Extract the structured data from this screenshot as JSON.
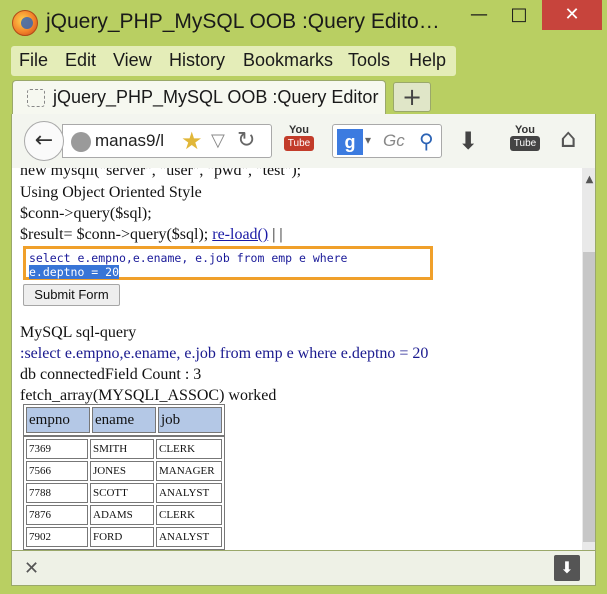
{
  "window": {
    "title": "jQuery_PHP_MySQL OOB :Query Edito…",
    "minimize": "—",
    "maximize": "□",
    "close": "✕"
  },
  "menu": [
    "File",
    "Edit",
    "View",
    "History",
    "Bookmarks",
    "Tools",
    "Help"
  ],
  "tab": {
    "title": "jQuery_PHP_MySQL OOB :Query Editor",
    "new_tab": "+"
  },
  "nav": {
    "back": "←",
    "url": "manas9/l",
    "search_placeholder": "Gc",
    "search_engine": "g",
    "youtube_label": "You",
    "youtube_sub": "Tube"
  },
  "content": {
    "line1": "new mysqli(\"server\", \"user\", \"pwd\", \"test\");",
    "line2": "Using Object Oriented Style",
    "line3": "$conn->query($sql);",
    "line4_prefix": "$result= $conn->query($sql); ",
    "reload_link": "re-load()",
    "line4_suffix": "| |",
    "query_part1": "select e.empno,e.ename, e.job from emp e where",
    "query_part2": "e.deptno = 20",
    "submit_label": "Submit Form",
    "sql_heading": "MySQL sql-query",
    "sql_query": ":select e.empno,e.ename, e.job from emp e where e.deptno = 20",
    "field_count": "db connectedField Count : 3",
    "fetch_status": "fetch_array(MYSQLI_ASSOC) worked"
  },
  "table": {
    "headers": [
      "empno",
      "ename",
      "job"
    ],
    "rows": [
      [
        "7369",
        "SMITH",
        "CLERK"
      ],
      [
        "7566",
        "JONES",
        "MANAGER"
      ],
      [
        "7788",
        "SCOTT",
        "ANALYST"
      ],
      [
        "7876",
        "ADAMS",
        "CLERK"
      ],
      [
        "7902",
        "FORD",
        "ANALYST"
      ]
    ]
  },
  "colors": {
    "frame": "#b9cf62",
    "close_button": "#c7443c",
    "query_border": "#f0a02a",
    "header_cell": "#b4c8e6",
    "selection": "#3875d7"
  }
}
